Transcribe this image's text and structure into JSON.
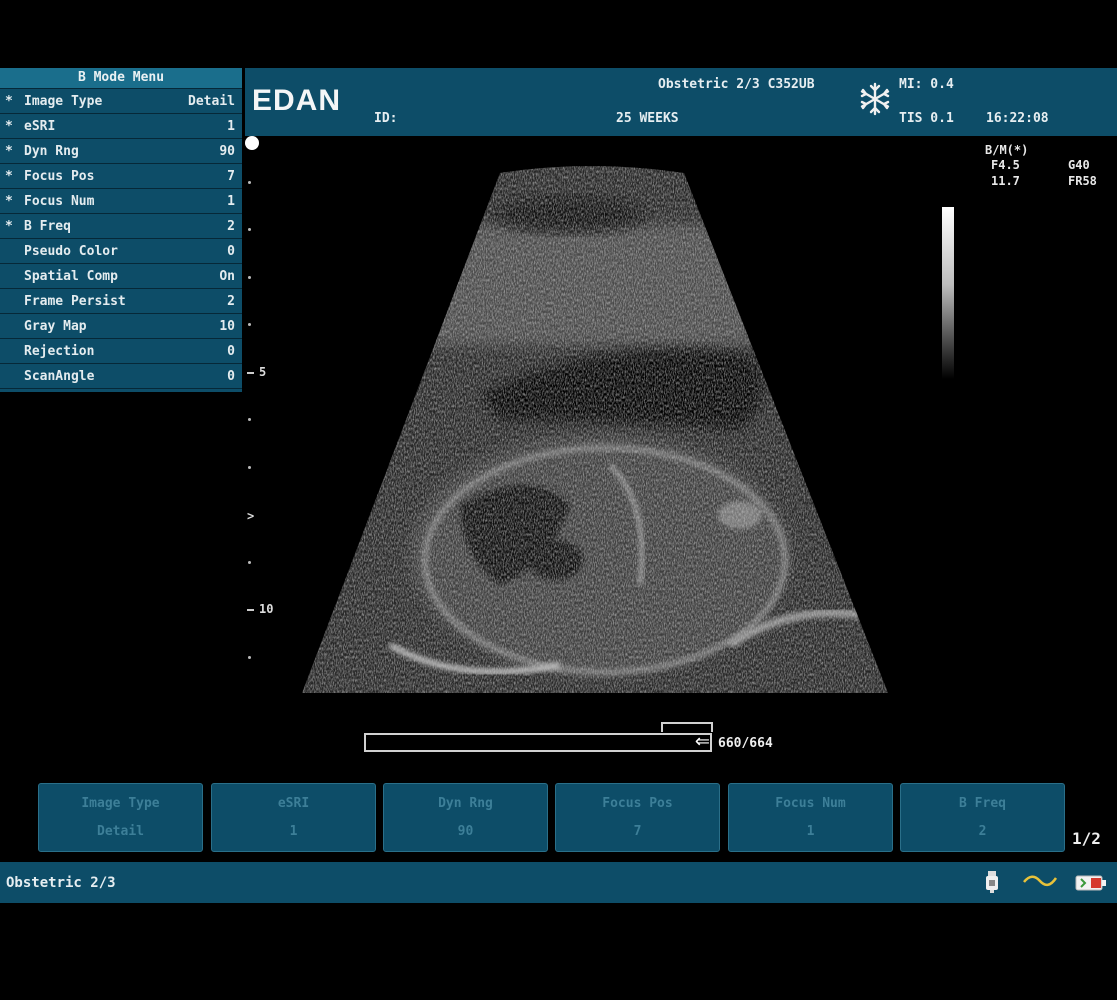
{
  "header": {
    "logo": "EDAN",
    "exam": "Obstetric 2/3 C352UB",
    "id_label": "ID:",
    "weeks": "25 WEEKS",
    "mi": "MI: 0.4",
    "tis": "TIS 0.1",
    "time": "16:22:08"
  },
  "menu": {
    "title": "B Mode Menu",
    "items": [
      {
        "star": "*",
        "label": "Image Type",
        "value": "Detail"
      },
      {
        "star": "*",
        "label": "eSRI",
        "value": "1"
      },
      {
        "star": "*",
        "label": "Dyn Rng",
        "value": "90"
      },
      {
        "star": "*",
        "label": "Focus Pos",
        "value": "7"
      },
      {
        "star": "*",
        "label": "Focus Num",
        "value": "1"
      },
      {
        "star": "*",
        "label": "B Freq",
        "value": "2"
      },
      {
        "star": "",
        "label": "Pseudo Color",
        "value": "0"
      },
      {
        "star": "",
        "label": "Spatial Comp",
        "value": "On"
      },
      {
        "star": "",
        "label": "Frame Persist",
        "value": "2"
      },
      {
        "star": "",
        "label": "Gray Map",
        "value": "10"
      },
      {
        "star": "",
        "label": "Rejection",
        "value": "0"
      },
      {
        "star": "",
        "label": "ScanAngle",
        "value": "0"
      }
    ]
  },
  "scale": {
    "mark5": "5",
    "mark10": "10",
    "focus": ">"
  },
  "info": {
    "mode": "B/M(*)",
    "freq": "F4.5",
    "gain": "G40",
    "depth": "11.7",
    "frame_rate": "FR58"
  },
  "cine": {
    "count": "660/664",
    "arrow": "⇐",
    "progress": 0.99
  },
  "softkeys": [
    {
      "label": "Image Type",
      "value": "Detail"
    },
    {
      "label": "eSRI",
      "value": "1"
    },
    {
      "label": "Dyn Rng",
      "value": "90"
    },
    {
      "label": "Focus Pos",
      "value": "7"
    },
    {
      "label": "Focus Num",
      "value": "1"
    },
    {
      "label": "B Freq",
      "value": "2"
    }
  ],
  "page_indicator": "1/2",
  "footer": {
    "label": "Obstetric 2/3"
  },
  "icons": {
    "freeze": "snowflake-icon",
    "probe": "probe-icon",
    "signal": "wave-icon",
    "battery": "battery-icon"
  },
  "colors": {
    "panel": "#0d4d68",
    "highlight": "#1a6e8c"
  }
}
